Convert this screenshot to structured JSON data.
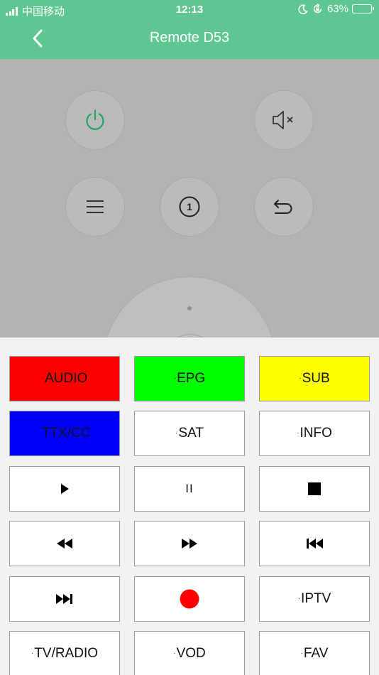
{
  "status_bar": {
    "carrier": "中国移动",
    "time": "12:13",
    "battery": "63%",
    "battery_level": 0.63
  },
  "nav": {
    "title": "Remote D53",
    "back_icon": "chevron-left-icon"
  },
  "remote": {
    "power_icon": "power-icon",
    "mute_icon": "mute-icon",
    "menu_icon": "menu-icon",
    "number_icon": "number-one-icon",
    "back_icon": "return-icon",
    "number_label": "1"
  },
  "colors": {
    "accent": "#5ec690",
    "power_icon": "#1fa463",
    "red": "#ff0000",
    "green": "#00ff00",
    "yellow": "#ffff00",
    "blue": "#0000ff",
    "record": "#ff0000"
  },
  "keys": {
    "audio": "AUDIO",
    "epg": "EPG",
    "sub": "SUB",
    "ttx": "TTX/CC",
    "sat": "SAT",
    "info": "INFO",
    "pause": "II",
    "iptv": "IPTV",
    "tvradio": "TV/RADIO",
    "vod": "VOD",
    "fav": "FAV"
  },
  "icons": {
    "play": "play-icon",
    "stop": "stop-icon",
    "rewind": "rewind-icon",
    "fast_forward": "fast-forward-icon",
    "skip_previous": "skip-previous-icon",
    "skip_next": "skip-next-icon",
    "record": "record-icon"
  }
}
